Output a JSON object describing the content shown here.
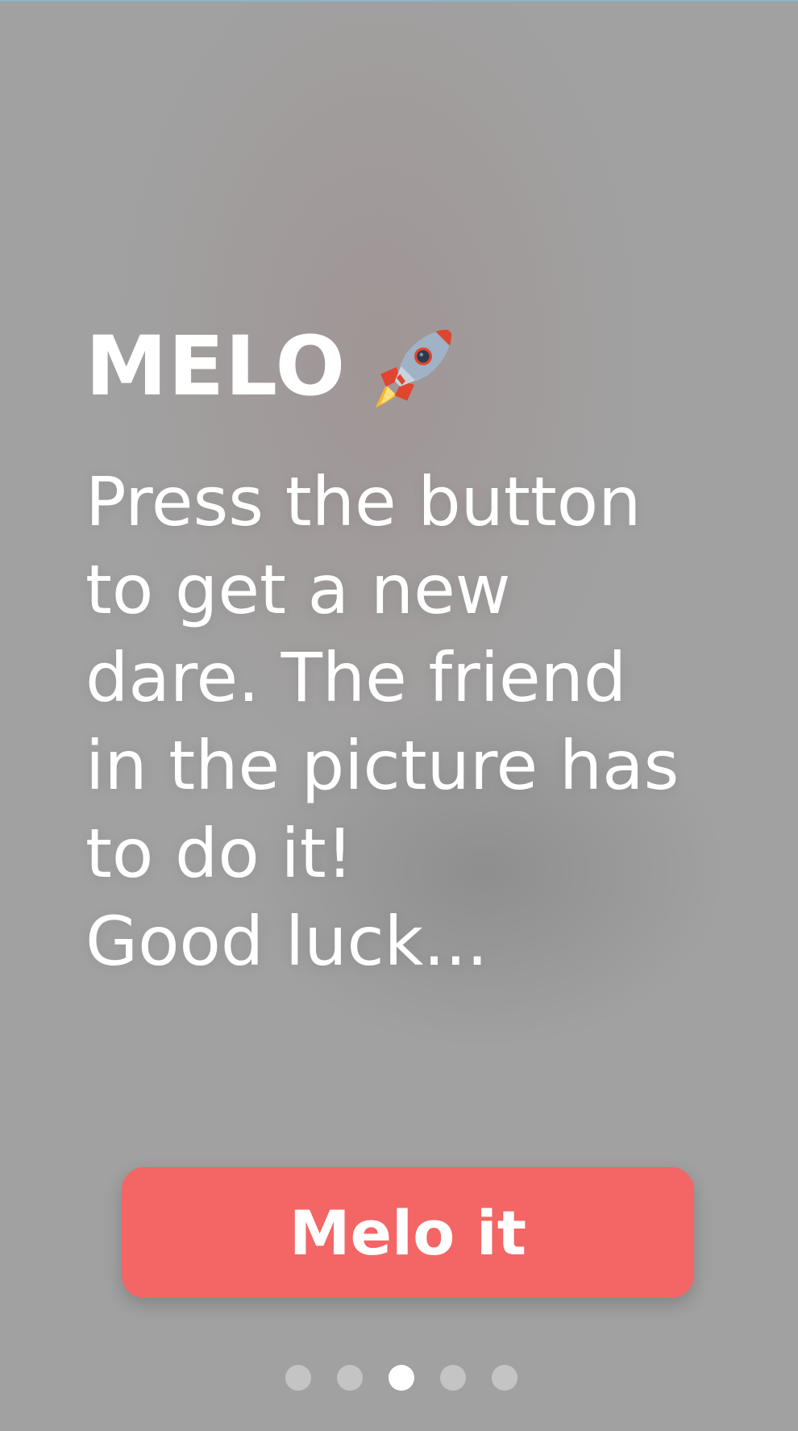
{
  "header": {
    "title": "MELO",
    "title_icon": "rocket-icon"
  },
  "main": {
    "instructions": "Press the button\nto get a new\ndare. The friend\nin the picture has\nto do it!\nGood luck..."
  },
  "action": {
    "button_label": "Melo it",
    "button_color": "#f46565"
  },
  "pager": {
    "page_count": 5,
    "active_page": 3
  },
  "colors": {
    "background": "#a1a1a1",
    "text": "#ffffff"
  }
}
